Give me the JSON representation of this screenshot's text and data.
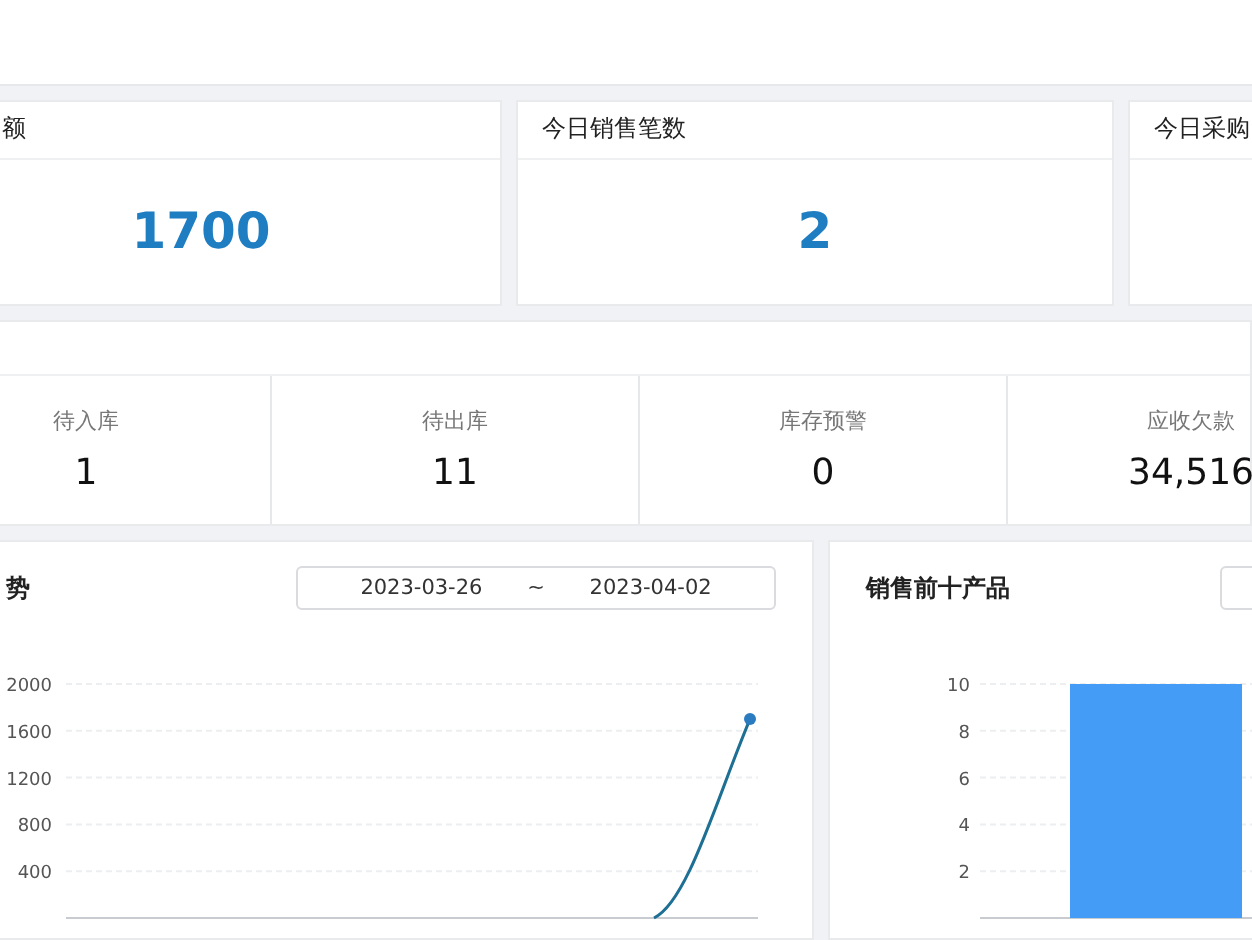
{
  "top_cards": [
    {
      "title": "额",
      "value": "1700"
    },
    {
      "title": "今日销售笔数",
      "value": "2"
    },
    {
      "title": "今日采购"
    }
  ],
  "todo": {
    "items": [
      {
        "label": "待入库",
        "value": "1"
      },
      {
        "label": "待出库",
        "value": "11"
      },
      {
        "label": "库存预警",
        "value": "0"
      },
      {
        "label": "应收欠款",
        "value": "34,516"
      }
    ]
  },
  "sales_trend": {
    "title": "势",
    "date_range": {
      "start": "2023-03-26",
      "separator": "~",
      "end": "2023-04-02"
    },
    "chart_data": {
      "type": "line",
      "ylim": [
        0,
        2000
      ],
      "grid": true,
      "yticks": [
        400,
        800,
        1200,
        1600,
        2000
      ],
      "values": [
        null,
        null,
        null,
        null,
        null,
        null,
        0,
        1700
      ]
    }
  },
  "top_products": {
    "title": "销售前十产品",
    "chart_data": {
      "type": "bar",
      "ylim": [
        0,
        10
      ],
      "grid": true,
      "yticks": [
        2,
        4,
        6,
        8,
        10
      ],
      "values": [
        10
      ]
    }
  }
}
